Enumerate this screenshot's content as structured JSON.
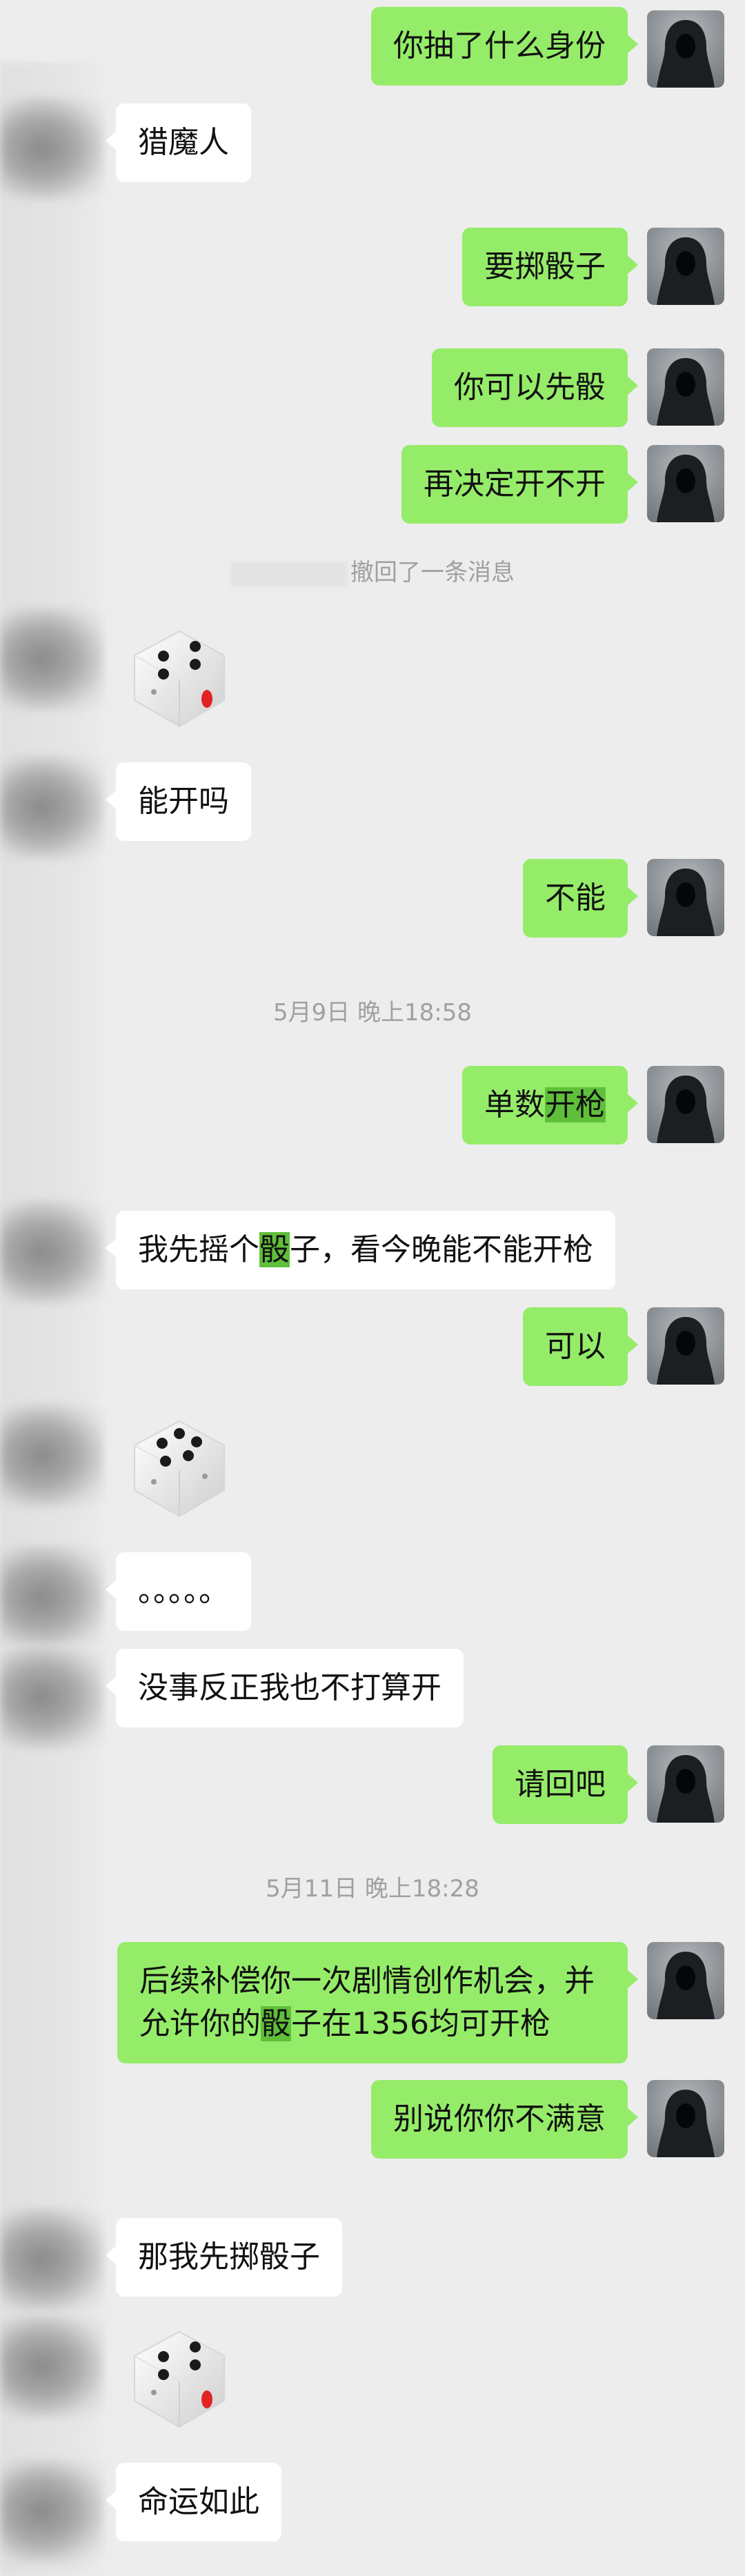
{
  "messages": {
    "m1": "你抽了什么身份",
    "m2": "猎魔人",
    "m3": "要掷骰子",
    "m4": "你可以先骰",
    "m5": "再决定开不开",
    "m6": "能开吗",
    "m7": "不能",
    "m8_a": "单数",
    "m8_b": "开枪",
    "m9_a": "我先摇个",
    "m9_b": "骰",
    "m9_c": "子，看今晚能不能开枪",
    "m10": "可以",
    "m11": "。。。。。",
    "m12": "没事反正我也不打算开",
    "m13": "请回吧",
    "m14_a": "后续补偿你一次剧情创作机会，并允许你的",
    "m14_b": "骰",
    "m14_c": "子在1356均可开枪",
    "m15": "别说你你不满意",
    "m16": "那我先掷骰子",
    "m17": "命运如此"
  },
  "system": {
    "recall": "撤回了一条消息",
    "time1": "5月9日 晚上18:58",
    "time2": "5月11日 晚上18:28"
  },
  "dice": {
    "roll1": 4,
    "roll2": 5,
    "roll3": 4
  }
}
